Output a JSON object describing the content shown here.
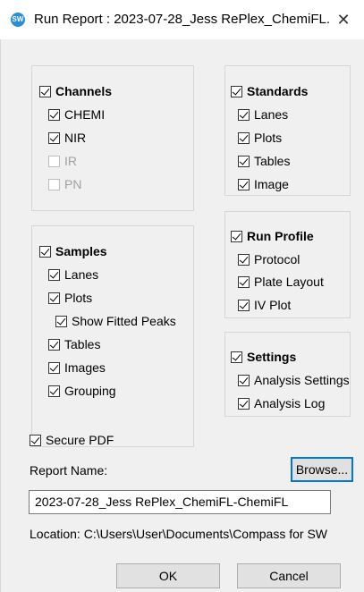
{
  "window": {
    "title": "Run Report : 2023-07-28_Jess RePlex_ChemiFL...",
    "app_icon_text": "SW",
    "close_glyph": "✕"
  },
  "channels": {
    "header": "Channels",
    "items": [
      {
        "label": "CHEMI",
        "checked": true,
        "enabled": true
      },
      {
        "label": "NIR",
        "checked": true,
        "enabled": true
      },
      {
        "label": "IR",
        "checked": false,
        "enabled": false
      },
      {
        "label": "PN",
        "checked": false,
        "enabled": false
      }
    ]
  },
  "standards": {
    "header": "Standards",
    "items": [
      {
        "label": "Lanes",
        "checked": true
      },
      {
        "label": "Plots",
        "checked": true
      },
      {
        "label": "Tables",
        "checked": true
      },
      {
        "label": "Image",
        "checked": true
      }
    ]
  },
  "samples": {
    "header": "Samples",
    "items": [
      {
        "label": "Lanes",
        "checked": true
      },
      {
        "label": "Plots",
        "checked": true
      },
      {
        "label": "Show Fitted Peaks",
        "checked": true
      },
      {
        "label": "Tables",
        "checked": true
      },
      {
        "label": "Images",
        "checked": true
      },
      {
        "label": "Grouping",
        "checked": true
      }
    ]
  },
  "run_profile": {
    "header": "Run Profile",
    "items": [
      {
        "label": "Protocol",
        "checked": true
      },
      {
        "label": "Plate Layout",
        "checked": true
      },
      {
        "label": "IV Plot",
        "checked": true
      }
    ]
  },
  "settings": {
    "header": "Settings",
    "items": [
      {
        "label": "Analysis Settings",
        "checked": true
      },
      {
        "label": "Analysis Log",
        "checked": true
      }
    ]
  },
  "secure_pdf": {
    "label": "Secure PDF",
    "checked": true
  },
  "report_name": {
    "label": "Report Name:",
    "browse_label": "Browse...",
    "value": "2023-07-28_Jess RePlex_ChemiFL-ChemiFL"
  },
  "location": {
    "text": "Location: C:\\Users\\User\\Documents\\Compass for SW"
  },
  "buttons": {
    "ok": "OK",
    "cancel": "Cancel"
  },
  "colors": {
    "accent": "#0078d7",
    "background": "#f0f0f0",
    "app_icon": "#2a8fd6"
  }
}
